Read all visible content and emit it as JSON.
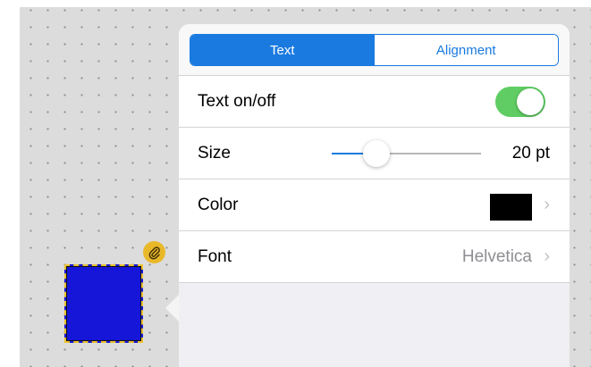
{
  "tabs": [
    {
      "label": "Text",
      "active": true
    },
    {
      "label": "Alignment",
      "active": false
    }
  ],
  "rows": {
    "text_toggle": {
      "label": "Text on/off",
      "on": true
    },
    "size": {
      "label": "Size",
      "value_label": "20 pt",
      "slider_fraction": 0.3
    },
    "color": {
      "label": "Color",
      "value_color": "#000000"
    },
    "font": {
      "label": "Font",
      "value": "Helvetica"
    }
  },
  "icons": {
    "chevron": "›",
    "badge": "paperclip-icon"
  },
  "colors": {
    "accent": "#1a7ae0",
    "toggle_on": "#5fcd63",
    "shape_fill": "#1616d8",
    "badge": "#e8b82a"
  }
}
